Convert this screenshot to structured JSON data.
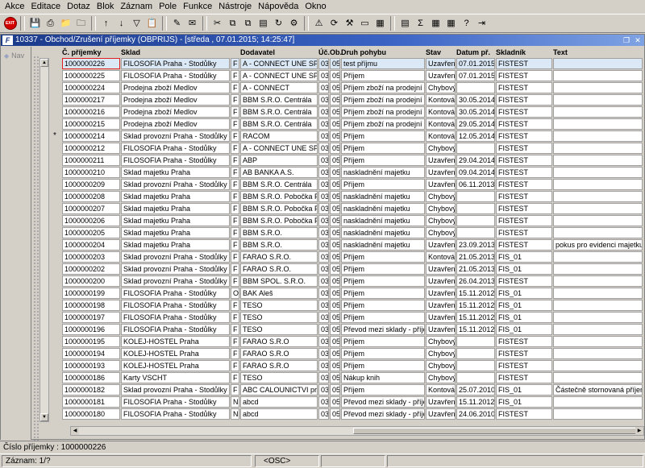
{
  "menu": [
    "Akce",
    "Editace",
    "Dotaz",
    "Blok",
    "Záznam",
    "Pole",
    "Funkce",
    "Nástroje",
    "Nápověda",
    "Okno"
  ],
  "toolbar": {
    "exit_label": "EXIT",
    "icons": [
      "save-icon",
      "print-icon",
      "folder-icon",
      "folder-delete-icon",
      "sort-asc-icon",
      "sort-desc-icon",
      "filter-icon",
      "paste-icon",
      "edit-icon",
      "mail-icon",
      "scissors-icon",
      "copy-icon",
      "copy-multi-icon",
      "paste-multi-icon",
      "refresh-icon",
      "gear-icon",
      "warning-icon",
      "refresh-arrows-icon",
      "tools-icon",
      "monitor-icon",
      "clipboard-icon",
      "document-icon",
      "sum-icon",
      "excel-icon",
      "calculator-icon",
      "help-icon",
      "exit-door-icon"
    ]
  },
  "window": {
    "title": "10337 - Obchod/Zrušení příjemky (OBPRIJS) - [středa , 07.01.2015; 14:25:47]",
    "nav_label": "Nav"
  },
  "columns": [
    "Č. příjemky",
    "Sklad",
    "Dodavatel",
    "Úč.",
    "Ob.",
    "Druh pohybu",
    "Stav",
    "Datum př.",
    "Skladník",
    "Text"
  ],
  "rows": [
    {
      "cislo": "1000000226",
      "sklad": "FILOSOFIA Praha - Stodůlky",
      "typ": "F",
      "dodavatel": "A - CONNECT UNE SPOL",
      "uc": "03",
      "ob": "05",
      "druh": "test příjmu",
      "stav": "Uzavřen",
      "datum": "07.01.2015",
      "skladnik": "FISTEST",
      "text": ""
    },
    {
      "cislo": "1000000225",
      "sklad": "FILOSOFIA Praha - Stodůlky",
      "typ": "F",
      "dodavatel": "A - CONNECT UNE SPOL",
      "uc": "03",
      "ob": "05",
      "druh": "Příjem",
      "stav": "Uzavřen",
      "datum": "07.01.2015",
      "skladnik": "FISTEST",
      "text": ""
    },
    {
      "cislo": "1000000224",
      "sklad": "Prodejna zboží Medlov",
      "typ": "F",
      "dodavatel": "A - CONNECT",
      "uc": "03",
      "ob": "05",
      "druh": "Příjem zboží na prodejní sklad",
      "stav": "Chybový",
      "datum": "",
      "skladnik": "FISTEST",
      "text": ""
    },
    {
      "cislo": "1000000217",
      "sklad": "Prodejna zboží Medlov",
      "typ": "F",
      "dodavatel": "BBM S.R.O. Centrála",
      "uc": "03",
      "ob": "05",
      "druh": "Příjem zboží na prodejní sklad",
      "stav": "Kontová",
      "datum": "30.05.2014",
      "skladnik": "FISTEST",
      "text": ""
    },
    {
      "cislo": "1000000216",
      "sklad": "Prodejna zboží Medlov",
      "typ": "F",
      "dodavatel": "BBM S.R.O. Centrála",
      "uc": "03",
      "ob": "05",
      "druh": "Příjem zboží na prodejní sklad",
      "stav": "Kontová",
      "datum": "30.05.2014",
      "skladnik": "FISTEST",
      "text": ""
    },
    {
      "cislo": "1000000215",
      "sklad": "Prodejna zboží Medlov",
      "typ": "F",
      "dodavatel": "BBM S.R.O. Centrála",
      "uc": "03",
      "ob": "05",
      "druh": "Příjem zboží na prodejní sklad",
      "stav": "Kontová",
      "datum": "29.05.2014",
      "skladnik": "FISTEST",
      "text": ""
    },
    {
      "cislo": "1000000214",
      "sklad": "Sklad provozní Praha - Stodůlky",
      "typ": "F",
      "dodavatel": "RACOM",
      "uc": "03",
      "ob": "05",
      "druh": "Příjem",
      "stav": "Kontová",
      "datum": "12.05.2014",
      "skladnik": "FISTEST",
      "text": "",
      "marker": "*"
    },
    {
      "cislo": "1000000212",
      "sklad": "FILOSOFIA Praha - Stodůlky",
      "typ": "F",
      "dodavatel": "A - CONNECT UNE SPOL",
      "uc": "03",
      "ob": "05",
      "druh": "Příjem",
      "stav": "Chybový",
      "datum": "",
      "skladnik": "FISTEST",
      "text": ""
    },
    {
      "cislo": "1000000211",
      "sklad": "FILOSOFIA Praha - Stodůlky",
      "typ": "F",
      "dodavatel": "ABP",
      "uc": "03",
      "ob": "05",
      "druh": "Příjem",
      "stav": "Uzavřen",
      "datum": "29.04.2014",
      "skladnik": "FISTEST",
      "text": ""
    },
    {
      "cislo": "1000000210",
      "sklad": "Sklad majetku Praha",
      "typ": "F",
      "dodavatel": "AB BANKA A.S.",
      "uc": "03",
      "ob": "05",
      "druh": "naskladnění majetku",
      "stav": "Uzavřen",
      "datum": "09.04.2014",
      "skladnik": "FISTEST",
      "text": ""
    },
    {
      "cislo": "1000000209",
      "sklad": "Sklad provozní Praha - Stodůlky",
      "typ": "F",
      "dodavatel": "BBM S.R.O. Centrála",
      "uc": "03",
      "ob": "05",
      "druh": "Příjem",
      "stav": "Uzavřen",
      "datum": "06.11.2013",
      "skladnik": "FISTEST",
      "text": ""
    },
    {
      "cislo": "1000000208",
      "sklad": "Sklad majetku Praha",
      "typ": "F",
      "dodavatel": "BBM S.R.O. Pobočka Praha",
      "uc": "03",
      "ob": "05",
      "druh": "naskladnění majetku",
      "stav": "Chybový",
      "datum": "",
      "skladnik": "FISTEST",
      "text": ""
    },
    {
      "cislo": "1000000207",
      "sklad": "Sklad majetku Praha",
      "typ": "F",
      "dodavatel": "BBM S.R.O. Pobočka Praha",
      "uc": "03",
      "ob": "05",
      "druh": "naskladnění majetku",
      "stav": "Chybový",
      "datum": "",
      "skladnik": "FISTEST",
      "text": ""
    },
    {
      "cislo": "1000000206",
      "sklad": "Sklad majetku Praha",
      "typ": "F",
      "dodavatel": "BBM S.R.O. Pobočka Praha",
      "uc": "03",
      "ob": "05",
      "druh": "naskladnění majetku",
      "stav": "Chybový",
      "datum": "",
      "skladnik": "FISTEST",
      "text": ""
    },
    {
      "cislo": "1000000205",
      "sklad": "Sklad majetku Praha",
      "typ": "F",
      "dodavatel": "BBM S.R.O.",
      "uc": "03",
      "ob": "05",
      "druh": "naskladnění majetku",
      "stav": "Chybový",
      "datum": "",
      "skladnik": "FISTEST",
      "text": ""
    },
    {
      "cislo": "1000000204",
      "sklad": "Sklad majetku Praha",
      "typ": "F",
      "dodavatel": "BBM S.R.O.",
      "uc": "03",
      "ob": "05",
      "druh": "naskladnění majetku",
      "stav": "Uzavřen",
      "datum": "23.09.2013",
      "skladnik": "FISTEST",
      "text": "pokus pro evidenci majetku"
    },
    {
      "cislo": "1000000203",
      "sklad": "Sklad provozní Praha - Stodůlky",
      "typ": "F",
      "dodavatel": "FARAO S.R.O.",
      "uc": "03",
      "ob": "05",
      "druh": "Příjem",
      "stav": "Kontová",
      "datum": "21.05.2013",
      "skladnik": "FIS_01",
      "text": ""
    },
    {
      "cislo": "1000000202",
      "sklad": "Sklad provozní Praha - Stodůlky",
      "typ": "F",
      "dodavatel": "FARAO S.R.O.",
      "uc": "03",
      "ob": "05",
      "druh": "Příjem",
      "stav": "Uzavřen",
      "datum": "21.05.2013",
      "skladnik": "FIS_01",
      "text": ""
    },
    {
      "cislo": "1000000200",
      "sklad": "Sklad provozní Praha - Stodůlky",
      "typ": "F",
      "dodavatel": "BBM SPOL. S.R.O.",
      "uc": "03",
      "ob": "05",
      "druh": "Příjem",
      "stav": "Uzavřen",
      "datum": "26.04.2013",
      "skladnik": "FISTEST",
      "text": ""
    },
    {
      "cislo": "1000000199",
      "sklad": "FILOSOFIA Praha - Stodůlky",
      "typ": "O",
      "dodavatel": "BAK Aleš",
      "uc": "03",
      "ob": "05",
      "druh": "Příjem",
      "stav": "Uzavřen",
      "datum": "15.11.2012",
      "skladnik": "FIS_01",
      "text": ""
    },
    {
      "cislo": "1000000198",
      "sklad": "FILOSOFIA Praha - Stodůlky",
      "typ": "F",
      "dodavatel": "TESO",
      "uc": "03",
      "ob": "05",
      "druh": "Příjem",
      "stav": "Uzavřen",
      "datum": "15.11.2012",
      "skladnik": "FIS_01",
      "text": ""
    },
    {
      "cislo": "1000000197",
      "sklad": "FILOSOFIA Praha - Stodůlky",
      "typ": "F",
      "dodavatel": "TESO",
      "uc": "03",
      "ob": "05",
      "druh": "Příjem",
      "stav": "Uzavřen",
      "datum": "15.11.2012",
      "skladnik": "FIS_01",
      "text": ""
    },
    {
      "cislo": "1000000196",
      "sklad": "FILOSOFIA Praha - Stodůlky",
      "typ": "F",
      "dodavatel": "TESO",
      "uc": "03",
      "ob": "05",
      "druh": "Převod mezi sklady - příjem",
      "stav": "Uzavřen",
      "datum": "15.11.2012",
      "skladnik": "FIS_01",
      "text": ""
    },
    {
      "cislo": "1000000195",
      "sklad": "KOLEJ-HOSTEL Praha",
      "typ": "F",
      "dodavatel": "FARAO S.R.O",
      "uc": "03",
      "ob": "05",
      "druh": "Příjem",
      "stav": "Chybový",
      "datum": "",
      "skladnik": "FISTEST",
      "text": ""
    },
    {
      "cislo": "1000000194",
      "sklad": "KOLEJ-HOSTEL Praha",
      "typ": "F",
      "dodavatel": "FARAO S.R.O",
      "uc": "03",
      "ob": "05",
      "druh": "Příjem",
      "stav": "Chybový",
      "datum": "",
      "skladnik": "FISTEST",
      "text": ""
    },
    {
      "cislo": "1000000193",
      "sklad": "KOLEJ-HOSTEL Praha",
      "typ": "F",
      "dodavatel": "FARAO S.R.O",
      "uc": "03",
      "ob": "05",
      "druh": "Příjem",
      "stav": "Chybový",
      "datum": "",
      "skladnik": "FISTEST",
      "text": ""
    },
    {
      "cislo": "1000000186",
      "sklad": "Karty VSCHT",
      "typ": "F",
      "dodavatel": "TESO",
      "uc": "03",
      "ob": "05",
      "druh": "Nákup knih",
      "stav": "Chybový",
      "datum": "",
      "skladnik": "FISTEST",
      "text": ""
    },
    {
      "cislo": "1000000182",
      "sklad": "Sklad provozní Praha - Stodůlky",
      "typ": "F",
      "dodavatel": "ABC CALOUNICTVI pro",
      "uc": "03",
      "ob": "05",
      "druh": "Příjem",
      "stav": "Kontová",
      "datum": "25.07.2010",
      "skladnik": "FIS_01",
      "text": "Částečně stornovaná příjem"
    },
    {
      "cislo": "1000000181",
      "sklad": "FILOSOFIA Praha - Stodůlky",
      "typ": "N",
      "dodavatel": "abcd",
      "uc": "03",
      "ob": "05",
      "druh": "Převod mezi sklady - příjem",
      "stav": "Uzavřen",
      "datum": "15.11.2012",
      "skladnik": "FIS_01",
      "text": ""
    },
    {
      "cislo": "1000000180",
      "sklad": "FILOSOFIA Praha - Stodůlky",
      "typ": "N",
      "dodavatel": "abcd",
      "uc": "03",
      "ob": "05",
      "druh": "Převod mezi sklady - příjem",
      "stav": "Uzavřen",
      "datum": "24.06.2010",
      "skladnik": "FISTEST",
      "text": ""
    }
  ],
  "status": {
    "field_info": "Číslo příjemky : 1000000226",
    "record": "Záznam: 1/?",
    "mode": "<OSC>"
  }
}
